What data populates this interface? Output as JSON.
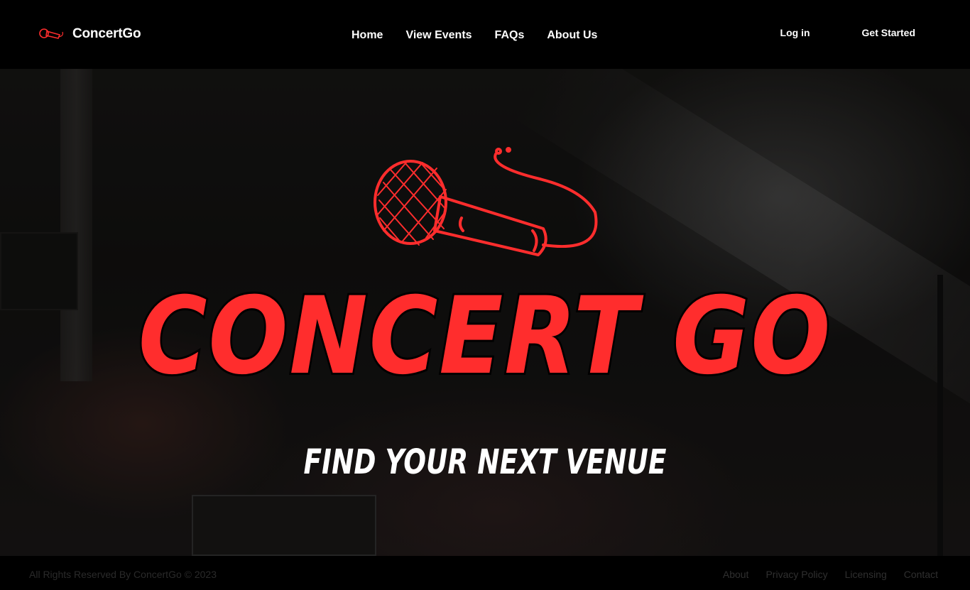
{
  "header": {
    "brand_name": "ConcertGo",
    "logo_icon": "microphone-icon",
    "nav": [
      {
        "label": "Home"
      },
      {
        "label": "View Events"
      },
      {
        "label": "FAQs"
      },
      {
        "label": "About Us"
      }
    ],
    "login_label": "Log in",
    "get_started_label": "Get Started"
  },
  "hero": {
    "illustration": "microphone-icon",
    "title": "CONCERT GO",
    "subtitle": "FIND YOUR NEXT VENUE"
  },
  "footer": {
    "copyright": "All Rights Reserved By ConcertGo © 2023",
    "links": [
      {
        "label": "About"
      },
      {
        "label": "Privacy Policy"
      },
      {
        "label": "Licensing"
      },
      {
        "label": "Contact"
      }
    ]
  },
  "colors": {
    "accent": "#ff2d2d",
    "background": "#000000",
    "text": "#ffffff"
  }
}
